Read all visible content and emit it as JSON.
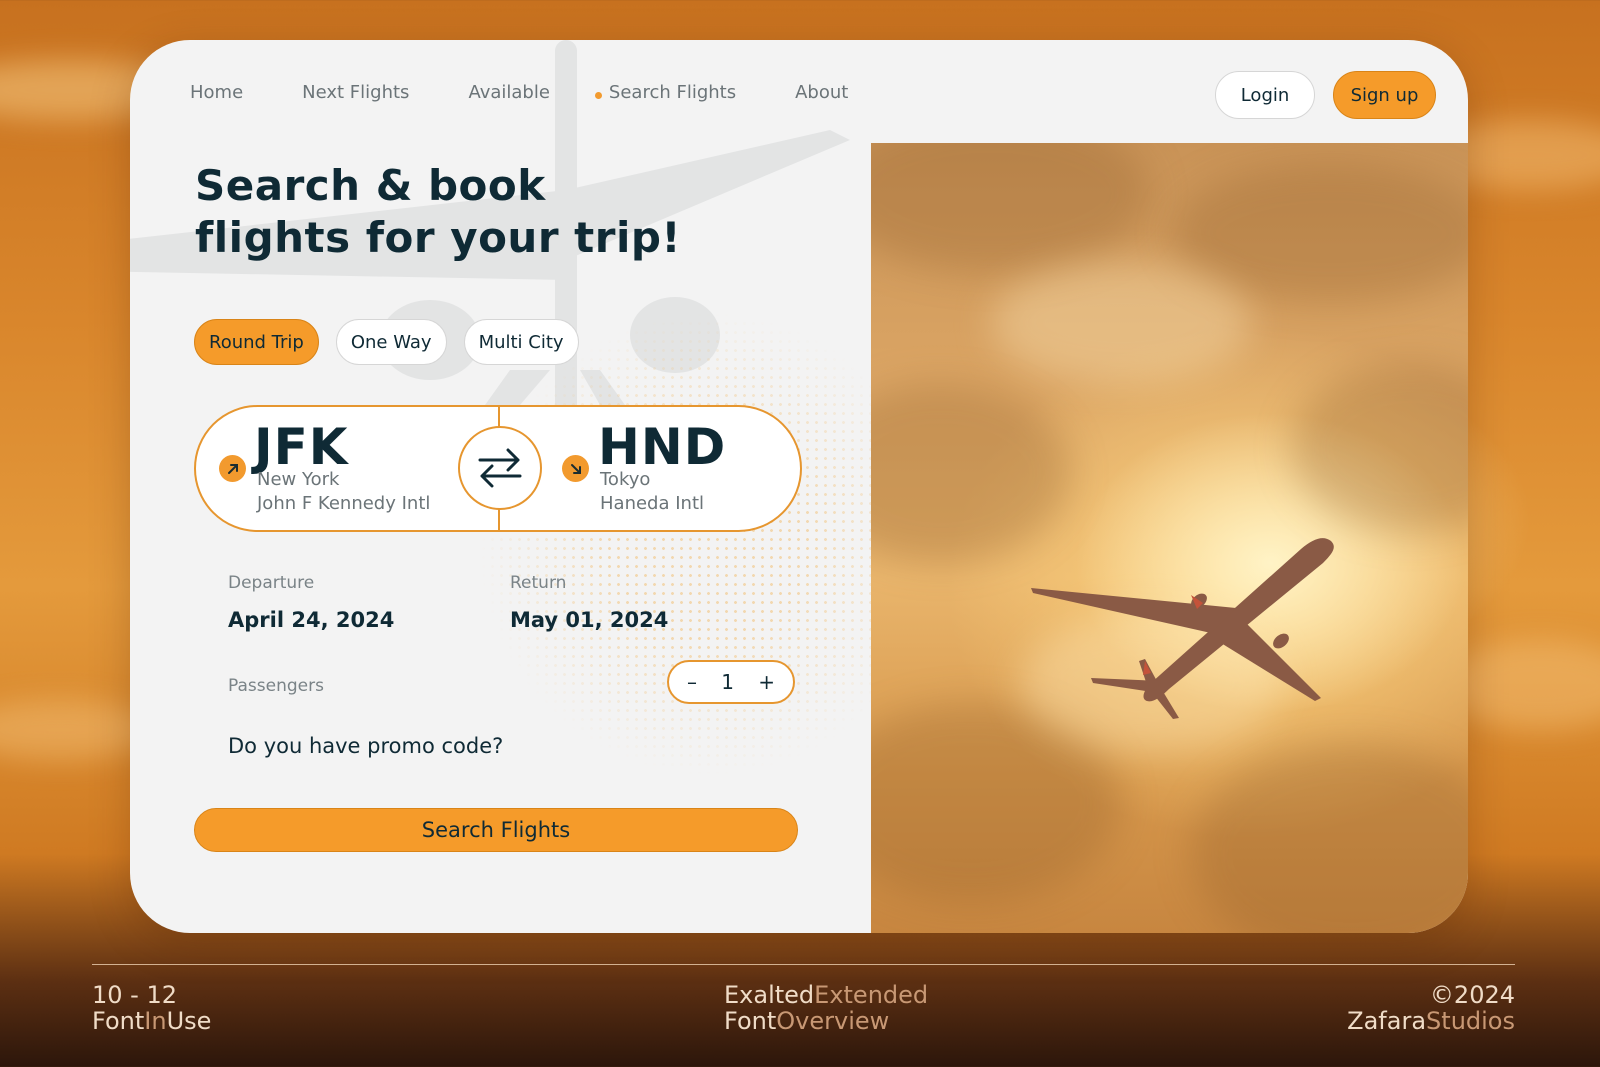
{
  "nav": {
    "items": [
      "Home",
      "Next Flights",
      "Available",
      "Search Flights",
      "About"
    ],
    "active_index": 3,
    "login_label": "Login",
    "signup_label": "Sign up"
  },
  "hero": {
    "line1": "Search & book",
    "line2": "flights for your trip!"
  },
  "trip_tabs": [
    "Round Trip",
    "One Way",
    "Multi City"
  ],
  "route": {
    "from": {
      "code": "JFK",
      "city": "New York",
      "airport": "John F Kennedy Intl",
      "icon": "arrow-up-right-icon"
    },
    "to": {
      "code": "HND",
      "city": "Tokyo",
      "airport": "Haneda Intl",
      "icon": "arrow-down-right-icon"
    },
    "swap_icon": "swap-arrows-icon"
  },
  "dates": {
    "departure_label": "Departure",
    "departure_value": "April 24, 2024",
    "return_label": "Return",
    "return_value": "May 01, 2024"
  },
  "passengers": {
    "label": "Passengers",
    "value": "1",
    "minus": "–",
    "plus": "+"
  },
  "promo_text": "Do you have promo code?",
  "search_button": "Search Flights",
  "footer": {
    "left_top": "10 - 12",
    "left_bottom_a": "Font",
    "left_bottom_b": "In",
    "left_bottom_c": "Use",
    "center_top_a": "Exalted",
    "center_top_b": "Extended",
    "center_bottom_a": "Font",
    "center_bottom_b": "Overview",
    "right_top": "©2024",
    "right_bottom_a": "Zafara",
    "right_bottom_b": "Studios"
  },
  "colors": {
    "accent": "#f59b2a",
    "text_dark": "#0f2a35",
    "card_bg": "#f3f3f3"
  }
}
